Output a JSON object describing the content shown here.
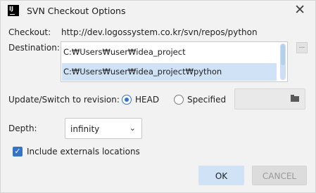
{
  "window": {
    "title": "SVN Checkout Options",
    "logo_text": "IJ"
  },
  "form": {
    "checkout_label": "Checkout:",
    "checkout_url": "http://dev.logossystem.co.kr/svn/repos/python",
    "destination_label": "Destination:",
    "destinations": [
      {
        "path": "C:₩Users₩user₩idea_project",
        "selected": false
      },
      {
        "path": "C:₩Users₩user₩idea_project₩python",
        "selected": true
      }
    ],
    "browse_label": "...",
    "revision_label": "Update/Switch to revision:",
    "revision_options": [
      {
        "label": "HEAD",
        "selected": true
      },
      {
        "label": "Specified",
        "selected": false
      }
    ],
    "revision_value": "",
    "depth_label": "Depth:",
    "depth_value": "infinity",
    "externals_label": "Include externals locations",
    "externals_checked": true
  },
  "buttons": {
    "ok": "OK",
    "cancel": "CANCEL"
  },
  "icons": {
    "close": "close-icon",
    "folder": "folder-icon",
    "chevron": "chevron-down-icon",
    "check": "checkmark-icon"
  },
  "colors": {
    "accent": "#3574c4",
    "selection": "#cfe2f6"
  }
}
